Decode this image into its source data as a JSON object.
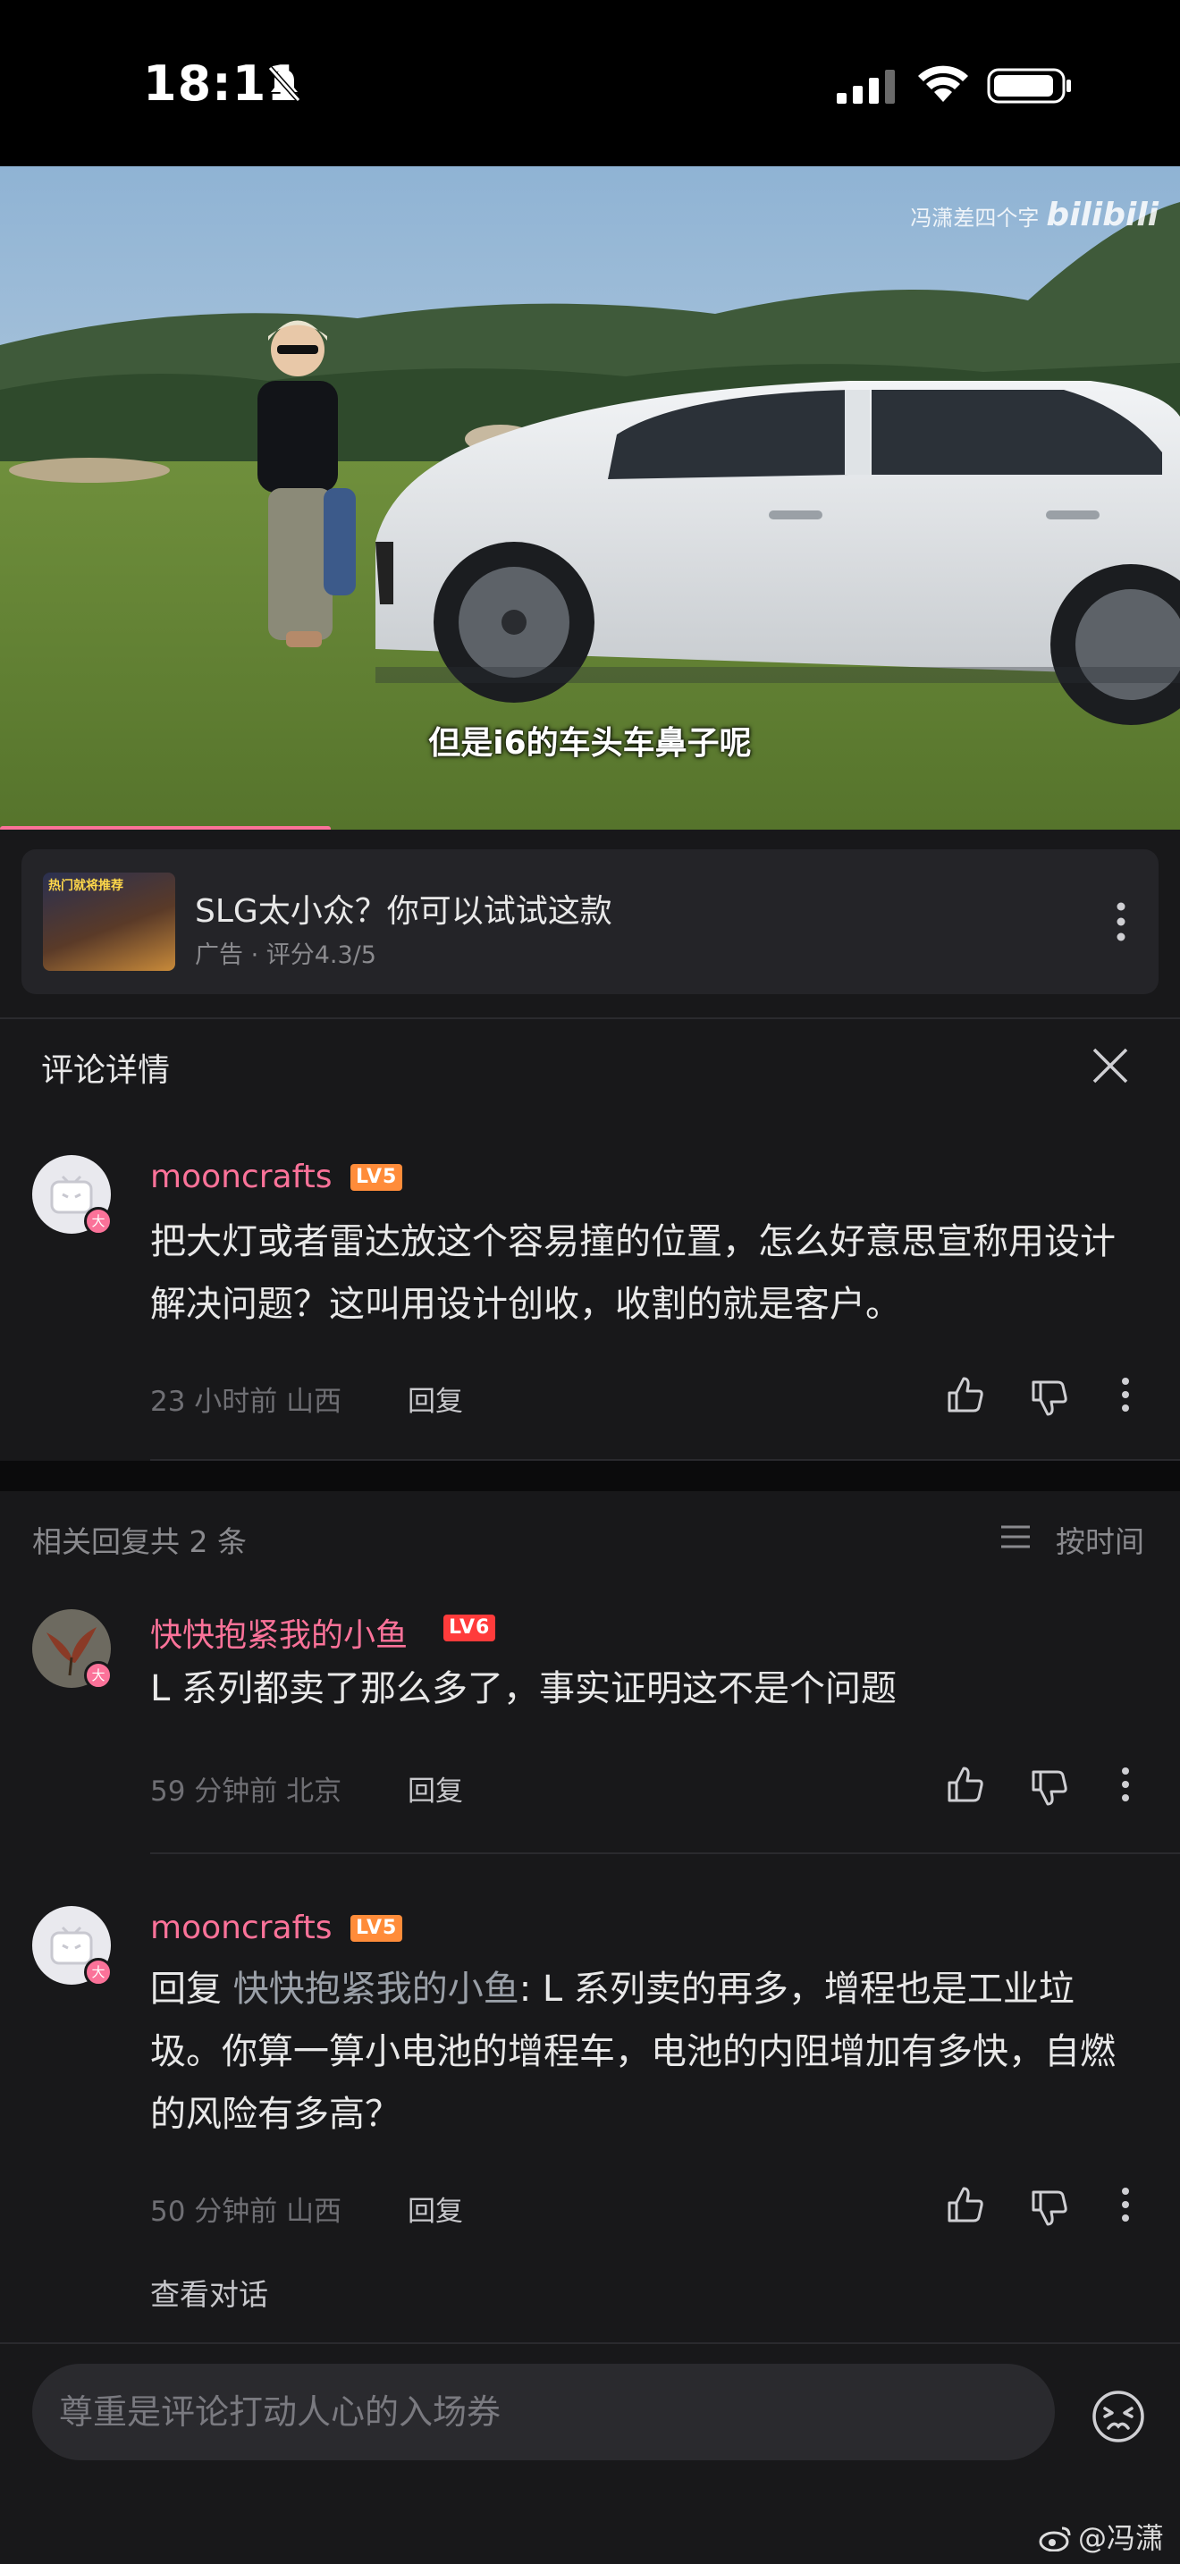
{
  "status_bar": {
    "time": "18:11"
  },
  "video": {
    "watermark_author": "冯潇差四个字",
    "watermark_brand": "bilibili",
    "subtitle": "但是i6的车头车鼻子呢",
    "progress_fraction": 0.28
  },
  "ad": {
    "thumb_text": "热门就将推荐",
    "title": "SLG太小众？你可以试试这款",
    "subtitle": "广告 · 评分4.3/5"
  },
  "panel": {
    "title": "评论详情"
  },
  "main_comment": {
    "username": "mooncrafts",
    "level": "LV5",
    "badge": "大",
    "text": "把大灯或者雷达放这个容易撞的位置，怎么好意思宣称用设计解决问题？这叫用设计创收，收割的就是客户。",
    "meta": "23 小时前  山西",
    "reply_label": "回复"
  },
  "replies_header": {
    "count_label": "相关回复共 2 条",
    "sort_label": "按时间"
  },
  "replies": [
    {
      "username": "快快抱紧我的小鱼",
      "level": "LV6",
      "badge": "大",
      "text": "L 系列都卖了那么多了，事实证明这不是个问题",
      "meta": "59 分钟前  北京",
      "reply_label": "回复"
    },
    {
      "username": "mooncrafts",
      "level": "LV5",
      "badge": "大",
      "reply_prefix": "回复 ",
      "mention": "快快抱紧我的小鱼",
      "text": ": L 系列卖的再多，增程也是工业垃圾。你算一算小电池的增程车，电池的内阻增加有多快，自燃的风险有多高？",
      "meta": "50 分钟前  山西",
      "reply_label": "回复",
      "view_conversation": "查看对话"
    }
  ],
  "input": {
    "placeholder": "尊重是评论打动人心的入场券"
  },
  "credit": "@冯潇",
  "colors": {
    "accent_pink": "#fb7299",
    "lv5": "#ff8c3a",
    "lv6": "#ff3b3b",
    "background": "#18181a"
  }
}
